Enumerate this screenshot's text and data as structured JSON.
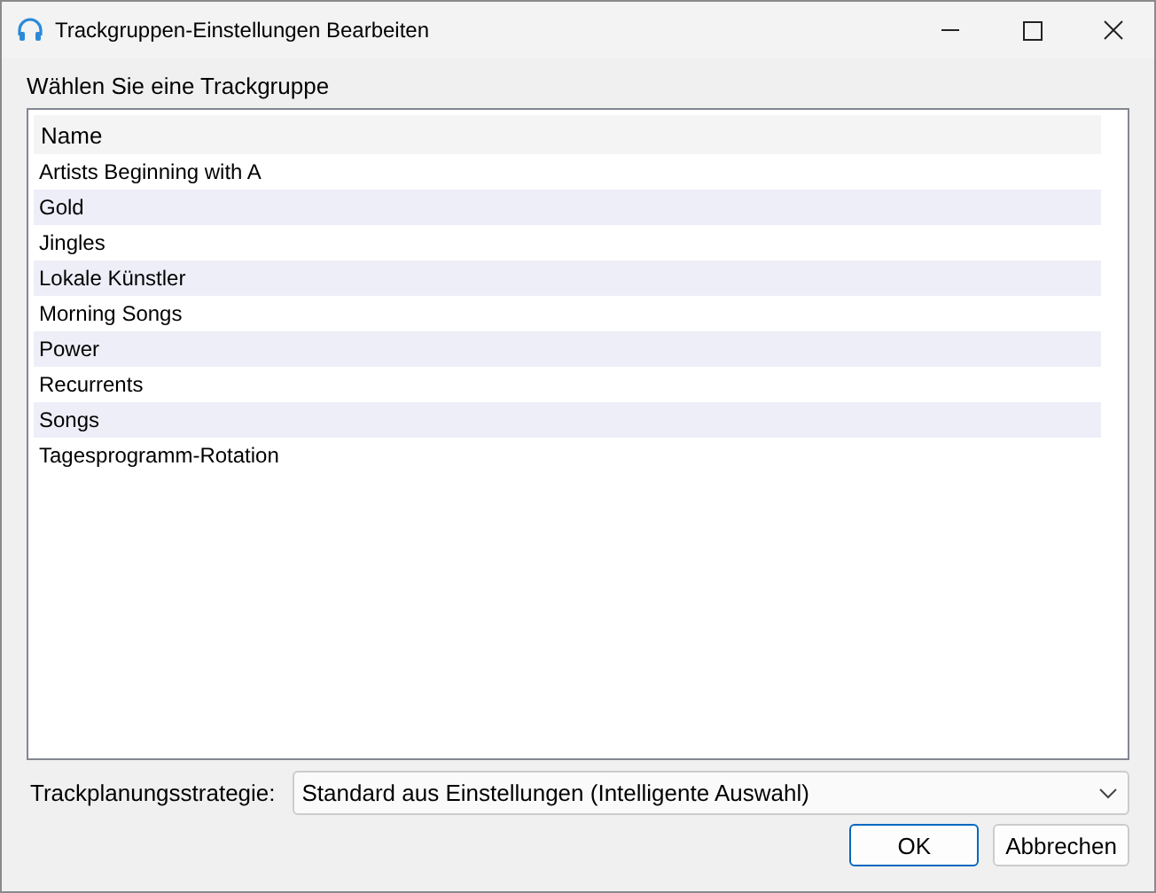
{
  "window": {
    "title": "Trackgruppen-Einstellungen Bearbeiten"
  },
  "list_label": "Wählen Sie eine Trackgruppe",
  "list": {
    "columns": [
      "Name"
    ],
    "rows": [
      "Artists Beginning with A",
      "Gold",
      "Jingles",
      "Lokale Künstler",
      "Morning Songs",
      "Power",
      "Recurrents",
      "Songs",
      "Tagesprogramm-Rotation"
    ]
  },
  "strategy": {
    "label": "Trackplanungsstrategie:",
    "value": "Standard aus Einstellungen (Intelligente Auswahl)"
  },
  "buttons": [
    {
      "label": "OK",
      "default": true
    },
    {
      "label": "Abbrechen",
      "default": false
    }
  ]
}
